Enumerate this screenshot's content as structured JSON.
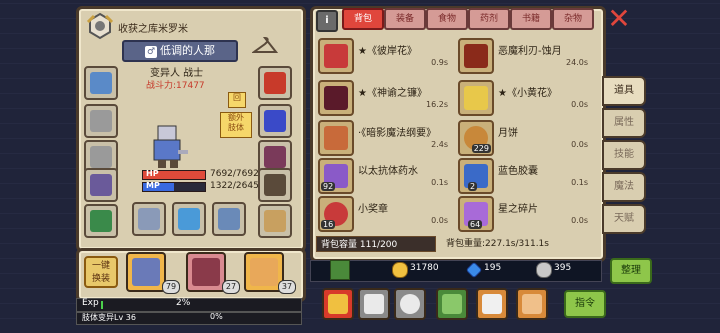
{
  "character": {
    "name": "收获之库米罗米",
    "title": "低调的人那",
    "race_class": "变异人 战士",
    "power": "战斗力:17477",
    "hp_label": "HP",
    "hp_value": "7692/7692",
    "mp_label": "MP",
    "mp_value": "1322/2645",
    "extra_tag": "额外\n肢体",
    "extra_tag_short": "额外肢体",
    "one_key": "一键\n换装",
    "pets": [
      {
        "level": "79"
      },
      {
        "level": "27"
      },
      {
        "level": "37"
      }
    ],
    "exp_label": "Exp",
    "exp_percent": "2%",
    "exp_progress": 0.02,
    "mutation_label": "肢体变异Lv 36",
    "mutation_percent": "0%"
  },
  "tabs": [
    {
      "label": "背包",
      "active": true
    },
    {
      "label": "装备",
      "active": false
    },
    {
      "label": "食物",
      "active": false
    },
    {
      "label": "药剂",
      "active": false
    },
    {
      "label": "书籍",
      "active": false
    },
    {
      "label": "杂物",
      "active": false
    }
  ],
  "items": [
    {
      "name": "★《彼岸花》",
      "time": "0.9s",
      "count": ""
    },
    {
      "name": "恶魔利刃-蚀月",
      "time": "24.0s",
      "count": ""
    },
    {
      "name": "★《神谕之镰》",
      "time": "16.2s",
      "count": ""
    },
    {
      "name": "★《小黄花》",
      "time": "0.0s",
      "count": ""
    },
    {
      "name": "·《暗影魔法纲要》",
      "time": "2.4s",
      "count": ""
    },
    {
      "name": "月饼",
      "time": "0.0s",
      "count": "229"
    },
    {
      "name": "以太抗体药水",
      "time": "0.1s",
      "count": "92"
    },
    {
      "name": "蓝色胶囊",
      "time": "0.1s",
      "count": "2"
    },
    {
      "name": "小奖章",
      "time": "0.0s",
      "count": "16"
    },
    {
      "name": "星之碎片",
      "time": "0.0s",
      "count": "64"
    }
  ],
  "bag": {
    "capacity": "背包容量 111/200",
    "weight": "背包重量:227.1s/311.1s"
  },
  "side_tabs": [
    {
      "label": "道具",
      "active": true
    },
    {
      "label": "属性",
      "active": false
    },
    {
      "label": "技能",
      "active": false
    },
    {
      "label": "魔法",
      "active": false
    },
    {
      "label": "天赋",
      "active": false
    }
  ],
  "currency": {
    "gold": "31780",
    "gem": "195",
    "silver": "395"
  },
  "buttons": {
    "organize": "整理",
    "command": "指令"
  },
  "colors": {
    "accent_red": "#e0463c",
    "panel": "#d9ceb0",
    "green_button": "#8ec64a"
  }
}
